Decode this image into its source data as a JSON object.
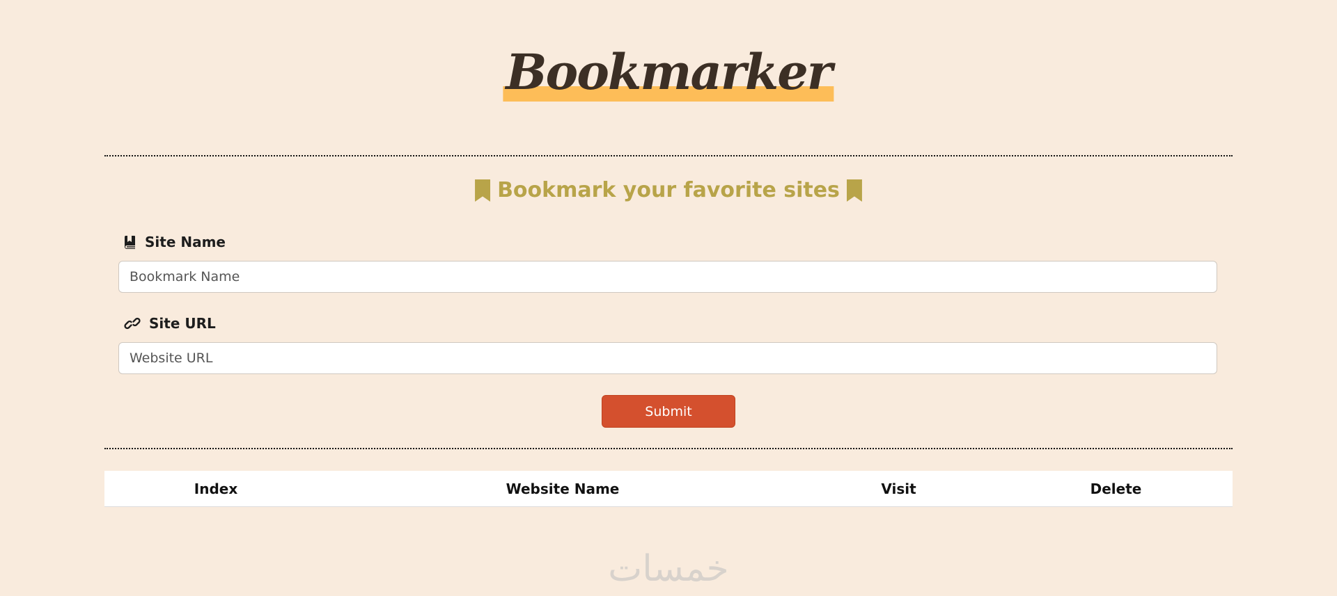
{
  "header": {
    "title": "Bookmarker"
  },
  "form": {
    "heading": "Bookmark your favorite sites",
    "site_name": {
      "label": "Site Name",
      "placeholder": "Bookmark Name",
      "value": ""
    },
    "site_url": {
      "label": "Site URL",
      "placeholder": "Website URL",
      "value": ""
    },
    "submit_label": "Submit"
  },
  "table": {
    "columns": [
      "Index",
      "Website Name",
      "Visit",
      "Delete"
    ],
    "rows": []
  },
  "watermark": {
    "text": "خمسات"
  },
  "colors": {
    "background": "#f9ebdd",
    "title": "#3c2f25",
    "title_highlight": "#fdbd58",
    "heading": "#b8a449",
    "submit": "#d4502e"
  },
  "icons": {
    "heading_left": "bookmark-icon",
    "heading_right": "bookmark-icon",
    "site_name": "book-bookmark-icon",
    "site_url": "link-icon"
  }
}
